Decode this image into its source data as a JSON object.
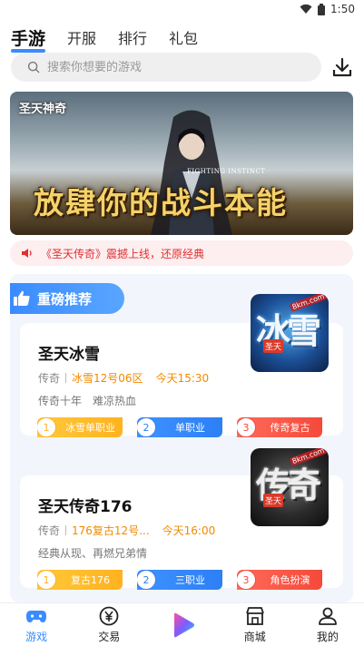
{
  "status_bar": {
    "time": "1:50",
    "wifi_icon": "wifi-icon",
    "battery_icon": "battery-icon"
  },
  "tabs": [
    {
      "label": "手游",
      "active": true
    },
    {
      "label": "开服",
      "active": false
    },
    {
      "label": "排行",
      "active": false
    },
    {
      "label": "礼包",
      "active": false
    }
  ],
  "search": {
    "placeholder": "搜索你想要的游戏",
    "icon": "search-icon"
  },
  "download": {
    "icon": "download-icon"
  },
  "banner": {
    "logo_text": "圣天神奇",
    "sub_text": "FIGHTING INSTINCT",
    "slogan": "放肆你的战斗本能"
  },
  "notice": {
    "text": "《圣天传奇》震撼上线，还原经典",
    "icon": "speaker-icon"
  },
  "recommend": {
    "title": "重磅推荐",
    "icon": "thumbs-up-icon",
    "games": [
      {
        "name": "圣天冰雪",
        "category": "传奇",
        "server": "冰雪12号06区",
        "time": "今天15:30",
        "desc": "传奇十年　难凉热血",
        "logo_text": "冰雪",
        "logo_badge": "圣天",
        "logo_site": "8km.com",
        "tags": [
          {
            "num": "1",
            "label": "冰雪单职业",
            "color": "#ffb21f"
          },
          {
            "num": "2",
            "label": "单职业",
            "color": "#2d7ff5"
          },
          {
            "num": "3",
            "label": "传奇复古",
            "color": "#f5493a"
          }
        ]
      },
      {
        "name": "圣天传奇176",
        "category": "传奇",
        "server": "176复古12号...",
        "time": "今天16:00",
        "desc": "经典从现、再燃兄弟情",
        "logo_text": "传奇",
        "logo_badge": "圣天",
        "logo_site": "8km.com",
        "tags": [
          {
            "num": "1",
            "label": "复古176",
            "color": "#ffb21f"
          },
          {
            "num": "2",
            "label": "三职业",
            "color": "#2d7ff5"
          },
          {
            "num": "3",
            "label": "角色扮演",
            "color": "#f5493a"
          }
        ]
      }
    ]
  },
  "bottom_nav": [
    {
      "label": "游戏",
      "icon": "gamepad-icon",
      "active": true
    },
    {
      "label": "交易",
      "icon": "yen-coin-icon",
      "active": false
    },
    {
      "label": "",
      "icon": "play-logo-icon",
      "active": false
    },
    {
      "label": "商城",
      "icon": "store-icon",
      "active": false
    },
    {
      "label": "我的",
      "icon": "user-icon",
      "active": false
    }
  ],
  "colors": {
    "accent": "#3a8bff",
    "notice_red": "#e03030",
    "highlight_orange": "#f08a00"
  }
}
